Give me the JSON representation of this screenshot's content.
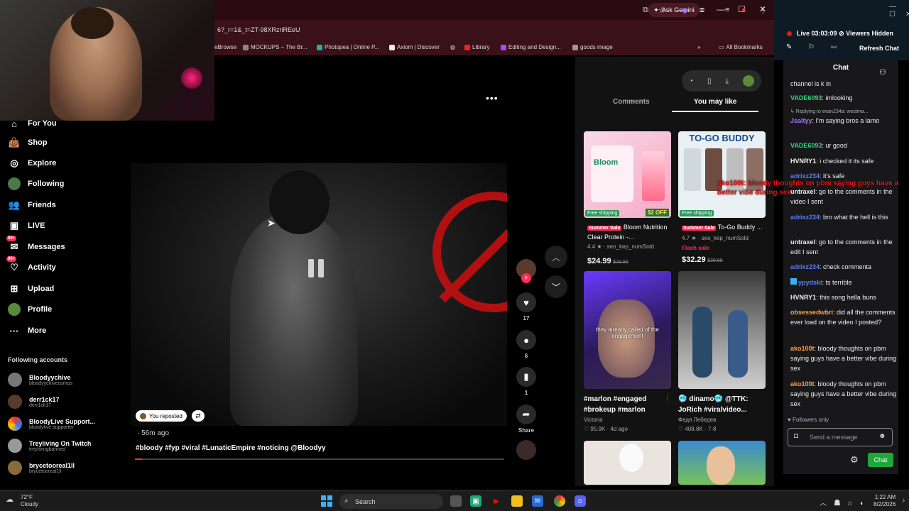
{
  "browser": {
    "ask_gemini": "Ask Gemini",
    "url": "6?_r=1&_t=ZT-98XRzriREeU",
    "bookmarks": [
      "eBrowse",
      "MOCKUPS – The Br...",
      "Photopea | Online P...",
      "Axiom | Discover",
      "Library",
      "Editing and Design...",
      "goods image",
      "All Bookmarks"
    ]
  },
  "sidebar": {
    "items": [
      {
        "label": "For You",
        "icon": "home-icon"
      },
      {
        "label": "Shop",
        "icon": "shop-bag-icon"
      },
      {
        "label": "Explore",
        "icon": "compass-icon"
      },
      {
        "label": "Following",
        "icon": "following-avatar-icon"
      },
      {
        "label": "Friends",
        "icon": "friends-icon"
      },
      {
        "label": "LIVE",
        "icon": "live-icon"
      },
      {
        "label": "Messages",
        "icon": "messages-icon",
        "badge": "99+"
      },
      {
        "label": "Activity",
        "icon": "activity-icon",
        "badge": "99+"
      },
      {
        "label": "Upload",
        "icon": "upload-icon"
      },
      {
        "label": "Profile",
        "icon": "profile-avatar-icon"
      },
      {
        "label": "More",
        "icon": "more-dots-icon"
      }
    ],
    "following_heading": "Following accounts",
    "accounts": [
      {
        "name": "Bloodyychive",
        "handle": "bloodyychivecomps"
      },
      {
        "name": "derr1ck17",
        "handle": "derr1ck17"
      },
      {
        "name": "BloodyLive Support...",
        "handle": "bloodylive.supporter"
      },
      {
        "name": "Treyliving On Twitch",
        "handle": "treylivingbanned"
      },
      {
        "name": "brycetooreal1ll",
        "handle": "brycetooreal1ll"
      }
    ]
  },
  "video": {
    "reposted": "You reposted",
    "posted_time": "· 56m ago",
    "caption": "#bloody #fyp #viral #LunaticEmpire #noticing @Bloodyy",
    "progress": 0.02,
    "likes": "17",
    "comments": "6",
    "saves": "1",
    "share_label": "Share"
  },
  "panel": {
    "tab_comments": "Comments",
    "tab_you_may_like": "You may like",
    "cards": [
      {
        "tag": "Summer Sale",
        "title": "Bloom Nutrition Clear Protein -...",
        "rating": "4.4 ★",
        "seller": "· seo_kep_numSold",
        "price": "$24.99",
        "old_price": "$29.99",
        "free_shipping": "Free shipping",
        "badge": "$2 OFF",
        "img_text": "Bloom"
      },
      {
        "tag": "Summer Sale",
        "title": "To-Go Buddy ...",
        "rating": "4.7 ★",
        "seller": "· seo_kep_numSold",
        "flash": "Flash sale",
        "price": "$32.29",
        "old_price": "$39.99",
        "free_shipping": "Free shipping",
        "img_text": "TO-GO BUDDY"
      },
      {
        "title": "#marlon #engaged #brokeup #marlon",
        "author": "Victoria",
        "likes": "♡ 95.9K",
        "time": "· 4d ago",
        "img_text": "they already called of the engagement"
      },
      {
        "title": "🥶 dinamo🥶 @TTK: JoRich #viralvideo...",
        "author": "Федя Лебедев",
        "likes": "♡ 408.8K",
        "time": "· 7-8"
      }
    ]
  },
  "overlay_chat": "ako100t: bloody thoughts on pbm saying guys have a better vibe during sex",
  "twitch": {
    "live_time": "Live 03:03:09",
    "viewers": "Viewers Hidden",
    "refresh": "Refresh Chat",
    "chat_title": "Chat",
    "messages": [
      {
        "user": "",
        "text": "channel is k in",
        "color": "#efeff1"
      },
      {
        "user": "VADE6093",
        "text": ": imlooking",
        "color": "#2fd67c"
      },
      {
        "user": "",
        "text": "↳ Replying to evan234a: westma...",
        "color": "#adadb8"
      },
      {
        "user": "Jsaltyy",
        "text": ": I'm saying bros a lamo",
        "color": "#a970ff"
      },
      {
        "user": "VADE6093",
        "text": ": ur good",
        "color": "#2fd67c"
      },
      {
        "user": "HVNRY1",
        "text": ": i checked it its safe",
        "color": "#efeff1"
      },
      {
        "user": "adrixz234",
        "text": ": it's safe",
        "color": "#5c7cfa"
      },
      {
        "user": "untraxel",
        "text": ": go to the comments in the video I sent",
        "color": "#efeff1"
      },
      {
        "user": "adrixz234",
        "text": ": bro what the hell is this",
        "color": "#5c7cfa"
      },
      {
        "user": "untraxel",
        "text": ": go to the comments in the edit I sent",
        "color": "#efeff1"
      },
      {
        "user": "adrixz234",
        "text": ": check commenta",
        "color": "#5c7cfa"
      },
      {
        "user": "ypydski",
        "text": ": ts terrible",
        "color": "#5c7cfa"
      },
      {
        "user": "HVNRY1",
        "text": ": this song hella buns",
        "color": "#efeff1"
      },
      {
        "user": "obsessedwbri",
        "text": ": did all the comments ever load on the video I posted?",
        "color": "#ff9f43"
      },
      {
        "user": "ako100t",
        "text": ": bloody thoughts on pbm saying guys have a better vibe during sex",
        "color": "#ff9f43"
      },
      {
        "user": "ako100t",
        "text": ": bloody thoughts on pbm saying guys have a better vibe during sex",
        "color": "#ff9f43"
      }
    ],
    "followers_only": "Followers only",
    "send_placeholder": "Send a message",
    "chat_button": "Chat"
  },
  "taskbar": {
    "temp": "72°F",
    "weather": "Cloudy",
    "search": "Search",
    "time": "1:22 AM",
    "date": "8/2/2026"
  }
}
